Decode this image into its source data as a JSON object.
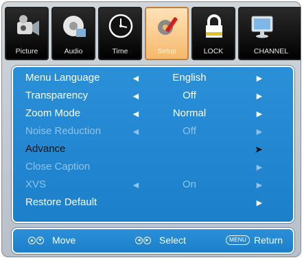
{
  "tabs": [
    {
      "label": "Picture",
      "icon": "camera-icon",
      "active": false
    },
    {
      "label": "Audio",
      "icon": "audio-disc-icon",
      "active": false
    },
    {
      "label": "Time",
      "icon": "clock-icon",
      "active": false
    },
    {
      "label": "Setup",
      "icon": "gear-wrench-icon",
      "active": true
    },
    {
      "label": "LOCK",
      "icon": "padlock-icon",
      "active": false
    },
    {
      "label": "CHANNEL",
      "icon": "monitor-icon",
      "active": false
    }
  ],
  "menu": [
    {
      "label": "Menu Language",
      "value": "English",
      "left_arrow": "◄",
      "right_arrow": "►",
      "state": "normal"
    },
    {
      "label": "Transparency",
      "value": "Off",
      "left_arrow": "◄",
      "right_arrow": "►",
      "state": "normal"
    },
    {
      "label": "Zoom Mode",
      "value": "Normal",
      "left_arrow": "◄",
      "right_arrow": "►",
      "state": "normal"
    },
    {
      "label": "Noise Reduction",
      "value": "Off",
      "left_arrow": "◄",
      "right_arrow": "►",
      "state": "disabled"
    },
    {
      "label": "Advance",
      "value": "",
      "left_arrow": "",
      "right_arrow": "➤",
      "state": "selected"
    },
    {
      "label": "Close Caption",
      "value": "",
      "left_arrow": "",
      "right_arrow": "►",
      "state": "disabled"
    },
    {
      "label": "XVS",
      "value": "On",
      "left_arrow": "◄",
      "right_arrow": "►",
      "state": "disabled"
    },
    {
      "label": "Restore Default",
      "value": "",
      "left_arrow": "",
      "right_arrow": "►",
      "state": "normal"
    }
  ],
  "hints": {
    "move": {
      "label": "Move",
      "glyph_a": "▲",
      "glyph_b": "▼"
    },
    "select": {
      "label": "Select",
      "glyph_a": "◄",
      "glyph_b": "►"
    },
    "return": {
      "label": "Return",
      "key": "MENU"
    }
  },
  "colors": {
    "panel": "#1c7fca",
    "active_tab": "#f5b86a",
    "disabled_text": "#8fc4ea",
    "selected_text": "#101010"
  }
}
